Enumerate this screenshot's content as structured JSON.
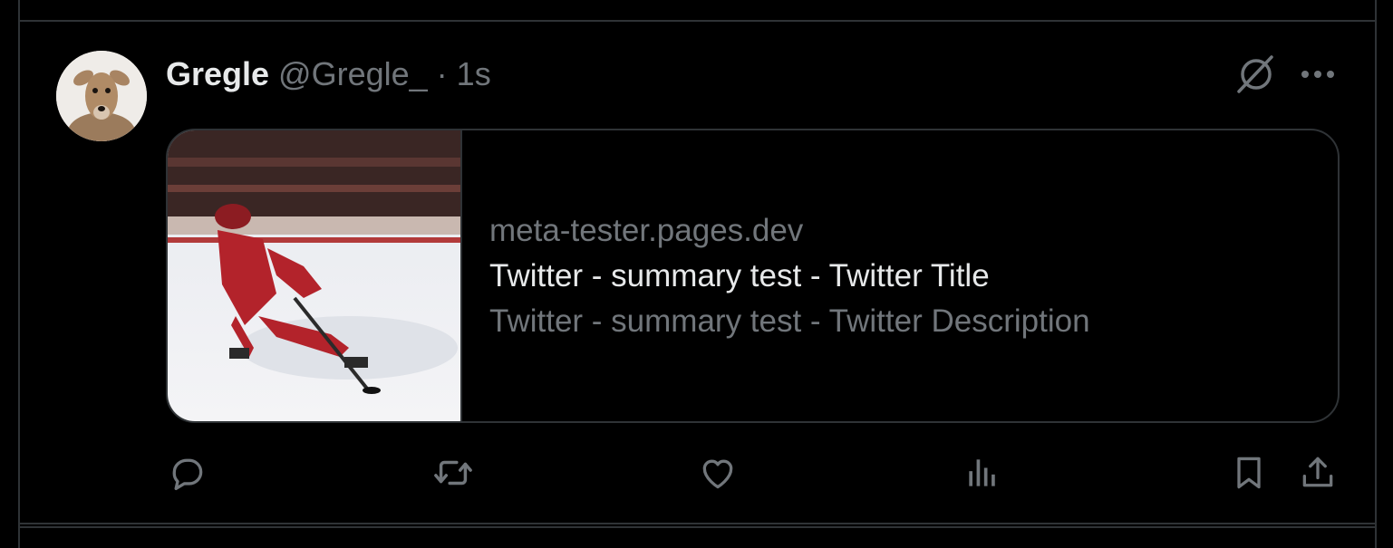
{
  "tweet": {
    "author_name": "Gregle",
    "author_handle": "@Gregle_",
    "separator": "·",
    "time": "1s"
  },
  "card": {
    "domain": "meta-tester.pages.dev",
    "title": "Twitter - summary test - Twitter Title",
    "description": "Twitter - summary test - Twitter Description"
  },
  "actions": [
    "reply-icon",
    "retweet-icon",
    "like-icon",
    "views-icon",
    "bookmark-icon",
    "share-icon"
  ],
  "colors": {
    "background": "#000000",
    "border": "#2f3336",
    "primary_text": "#e7e9ea",
    "secondary_text": "#71767b"
  }
}
